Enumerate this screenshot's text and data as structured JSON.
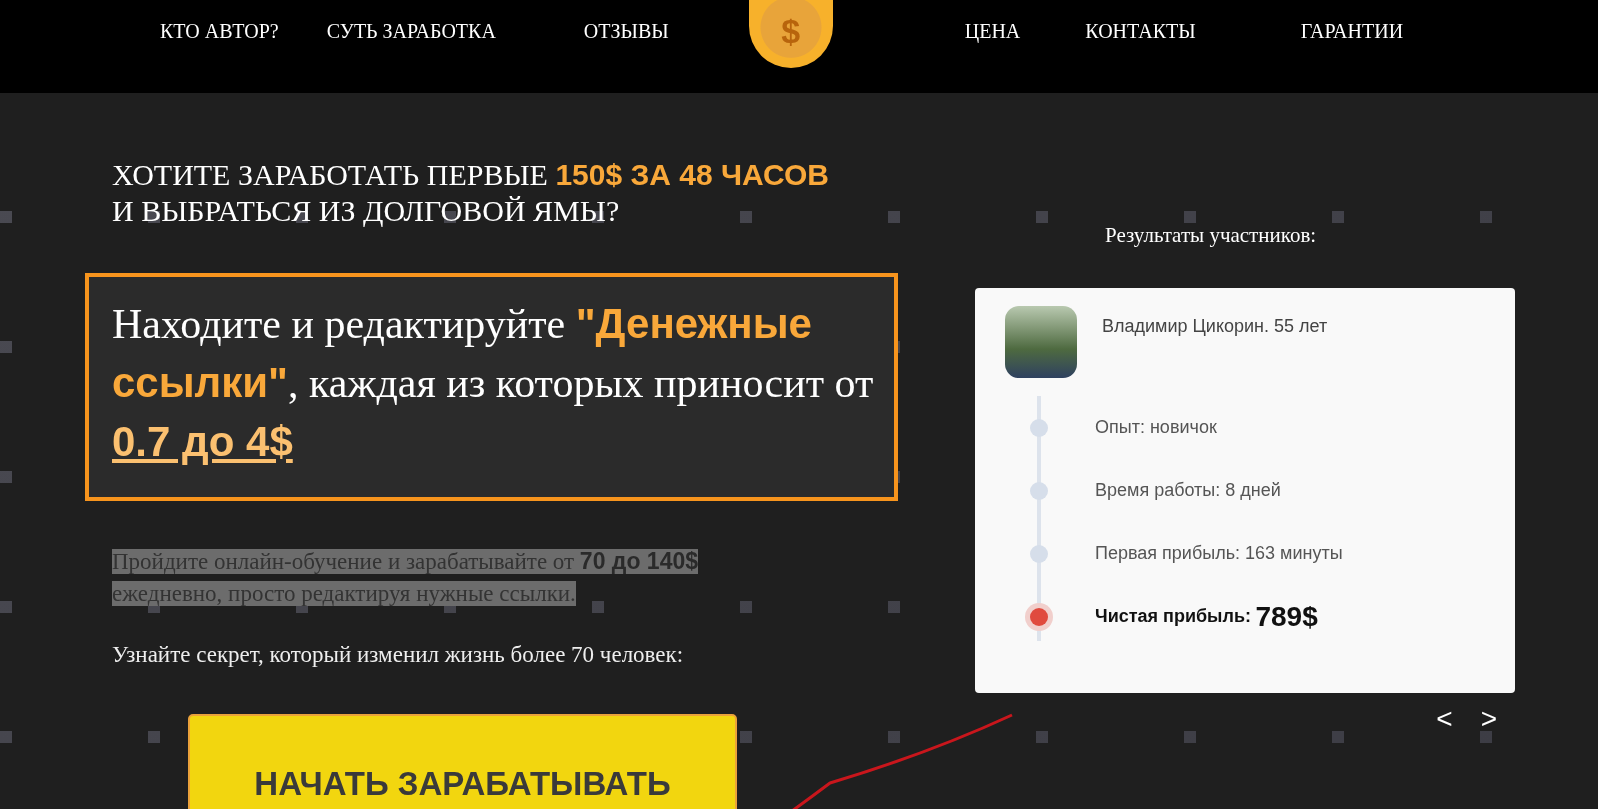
{
  "nav": {
    "items_left": [
      "КТО АВТОР?",
      "СУТЬ ЗАРАБОТКА",
      "ОТЗЫВЫ"
    ],
    "logo_symbol": "$",
    "items_right": [
      "ЦЕНА",
      "КОНТАКТЫ",
      "ГАРАНТИИ"
    ]
  },
  "hero": {
    "headline_lines": [
      "ХОТИТЕ ЗАРАБОТАТЬ ПЕРВЫЕ **150$ ЗА 48 ЧАСОВ**",
      "И ВЫБРАТЬСЯ ИЗ ДОЛГОВОЙ ЯМЫ?"
    ],
    "offer": "Находите и редактируйте **\"Денежные ссылки\"**, каждая из которых приносит от *0.7 до 4$*",
    "highlight": "Пройдите онлайн-обучение и зарабатывайте от **70 до 140$** ежедневно, просто редактируя нужные ссылки.",
    "secret": "Узнайте секрет, который изменил жизнь более 70 человек:",
    "button": "НАЧАТЬ ЗАРАБАТЫВАТЬ"
  },
  "results": {
    "title": "Результаты участников:",
    "card": {
      "name": "Владимир Цикорин. 55 лет",
      "items": [
        {
          "kind": "step",
          "label": "Опыт: новичок"
        },
        {
          "kind": "step",
          "label": "Время работы: 8 дней"
        },
        {
          "kind": "step",
          "label": "Первая прибыль: 163 минуты"
        },
        {
          "kind": "result",
          "label": "Чистая прибыль:",
          "value": "789$"
        }
      ]
    },
    "prev": "<",
    "next": ">"
  }
}
